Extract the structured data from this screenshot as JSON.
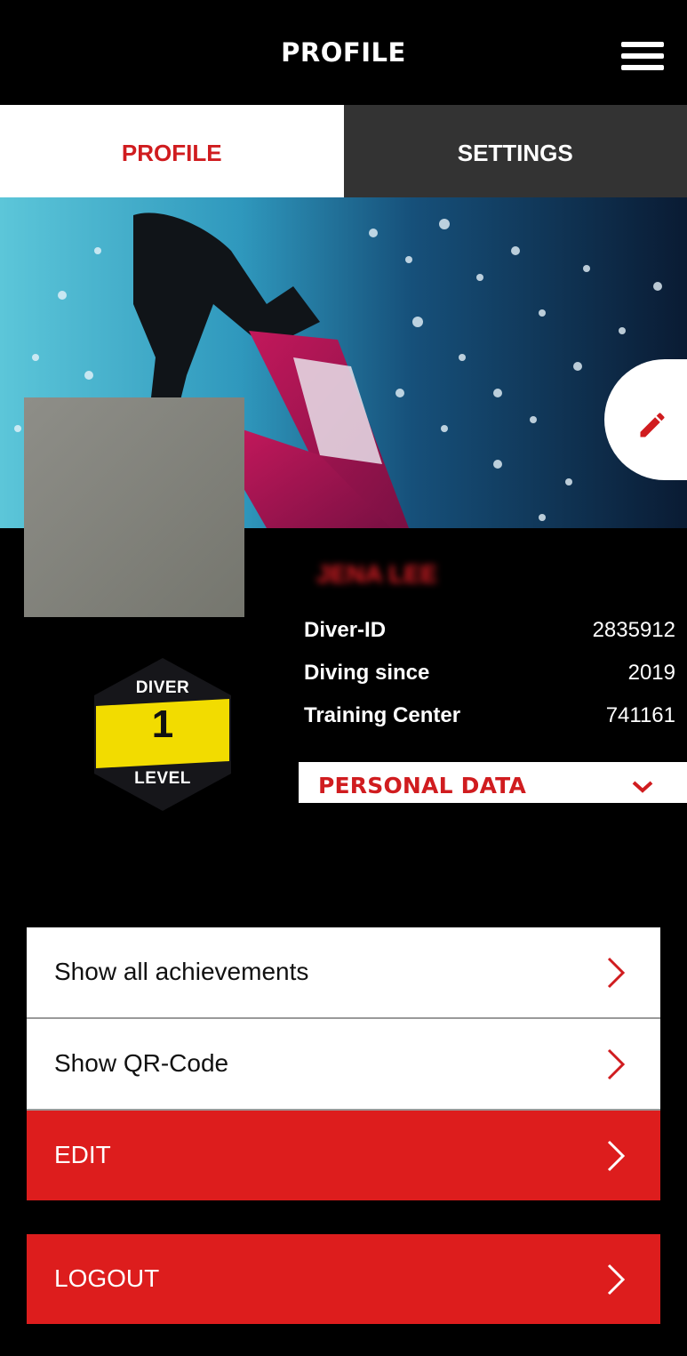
{
  "header": {
    "title": "PROFILE",
    "menu_icon": "hamburger-menu-icon"
  },
  "tabs": [
    {
      "label": "PROFILE",
      "active": true
    },
    {
      "label": "SETTINGS",
      "active": false
    }
  ],
  "cover": {
    "edit_icon": "pencil-icon"
  },
  "badge": {
    "top": "DIVER",
    "level": "1",
    "bottom": "LEVEL"
  },
  "profile": {
    "name": "JENA LEE",
    "fields": [
      {
        "label": "Diver-ID",
        "value": "2835912"
      },
      {
        "label": "Diving since",
        "value": "2019"
      },
      {
        "label": "Training Center",
        "value": "741161"
      }
    ],
    "personal_data_label": "PERSONAL DATA"
  },
  "actions": [
    {
      "label": "Show all achievements"
    },
    {
      "label": "Show QR-Code"
    },
    {
      "label": "EDIT"
    },
    {
      "label": "LOGOUT"
    }
  ],
  "colors": {
    "accent": "#d01c1f",
    "button_red": "#dd1d1d",
    "tab_inactive": "#333333",
    "badge_yellow": "#f2dc00"
  }
}
